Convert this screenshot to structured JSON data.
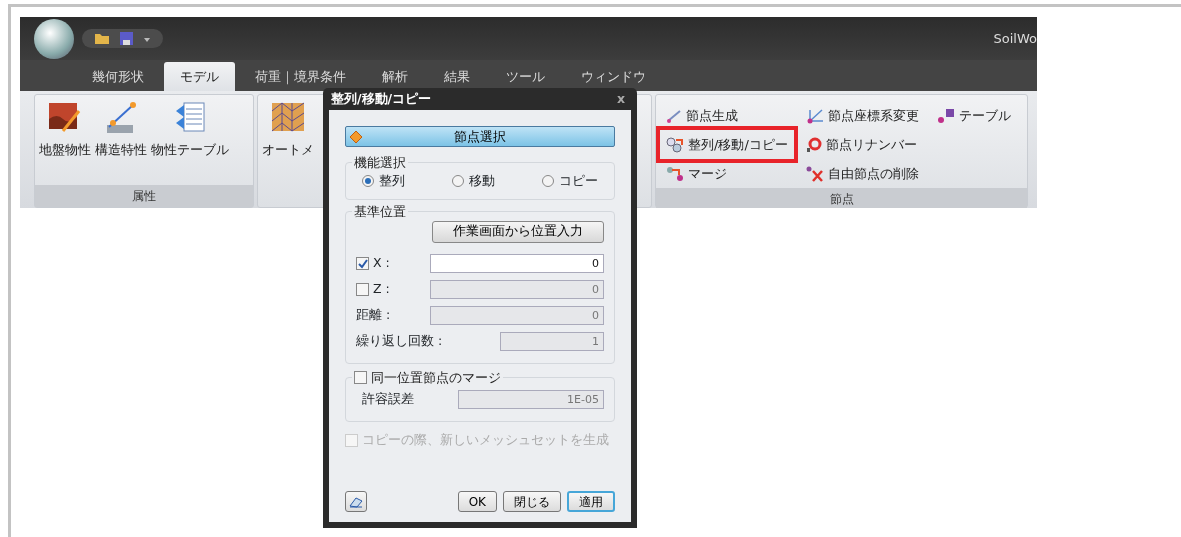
{
  "app": {
    "title": "SoilWo"
  },
  "ribbon_tabs": [
    {
      "label": "幾何形状",
      "selected": false
    },
    {
      "label": "モデル",
      "selected": true
    },
    {
      "label": "荷重｜境界条件",
      "selected": false
    },
    {
      "label": "解析",
      "selected": false
    },
    {
      "label": "結果",
      "selected": false
    },
    {
      "label": "ツール",
      "selected": false
    },
    {
      "label": "ウィンドウ",
      "selected": false
    }
  ],
  "ribbon_groups": [
    {
      "label": "属性",
      "kind": "large",
      "items": [
        {
          "label": "地盤物性"
        },
        {
          "label": "構造特性"
        },
        {
          "label": "物性テーブル"
        }
      ]
    },
    {
      "kind": "large",
      "items": [
        {
          "label": "オートメ"
        }
      ]
    },
    {
      "label": "節点",
      "kind": "small",
      "items": [
        {
          "label": "節点生成",
          "highlighted": false
        },
        {
          "label": "整列/移動/コピー",
          "highlighted": true
        },
        {
          "label": "マージ",
          "highlighted": false
        },
        {
          "label": "節点座標系変更",
          "highlighted": false
        },
        {
          "label": "節点リナンバー",
          "highlighted": false
        },
        {
          "label": "自由節点の削除",
          "highlighted": false
        },
        {
          "label": "テーブル",
          "highlighted": false
        }
      ]
    }
  ],
  "dialog": {
    "title": "整列/移動/コピー",
    "close": "x",
    "select_button": "節点選択",
    "function_group": {
      "label": "機能選択",
      "options": [
        {
          "label": "整列",
          "selected": true
        },
        {
          "label": "移動",
          "selected": false
        },
        {
          "label": "コピー",
          "selected": false
        }
      ]
    },
    "reference_group": {
      "label": "基準位置",
      "pick_button": "作業画面から位置入力",
      "fields": [
        {
          "label": "X :",
          "kind": "check",
          "checked": true,
          "value": "0"
        },
        {
          "label": "Z :",
          "kind": "check",
          "checked": false,
          "value": "0"
        },
        {
          "label": "距離 :",
          "kind": "plain",
          "value": "0"
        },
        {
          "label": "繰り返し回数 :",
          "kind": "short",
          "value": "1"
        }
      ]
    },
    "merge_group": {
      "label": "同一位置節点のマージ",
      "checked": false,
      "tolerance_label": "許容誤差",
      "tolerance_value": "1E-05"
    },
    "copy_option": {
      "label": "コピーの際、新しいメッシュセットを生成",
      "checked": false,
      "disabled": true
    },
    "buttons": [
      {
        "label": "OK",
        "default": false
      },
      {
        "label": "閉じる",
        "default": false
      },
      {
        "label": "適用",
        "default": true
      }
    ]
  }
}
